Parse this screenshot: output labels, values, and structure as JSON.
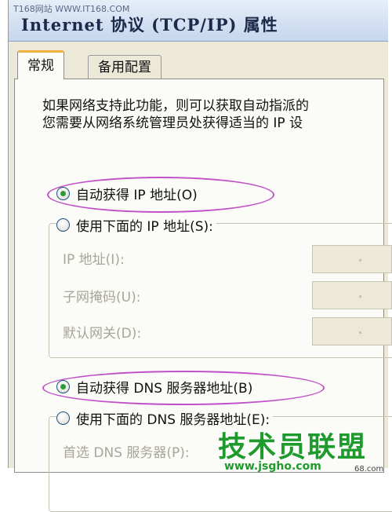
{
  "watermark_top": "T168网站 WWW.IT168.COM",
  "window": {
    "title": "Internet 协议 (TCP/IP) 属性"
  },
  "tabs": [
    {
      "label": "常规",
      "active": true
    },
    {
      "label": "备用配置",
      "active": false
    }
  ],
  "description": {
    "line1": "如果网络支持此功能，则可以获取自动指派的",
    "line2": "您需要从网络系统管理员处获得适当的 IP 设"
  },
  "ip": {
    "auto_label": "自动获得 IP 地址(O)",
    "auto_selected": true,
    "manual_label": "使用下面的 IP 地址(S):",
    "manual_selected": false,
    "fields": [
      {
        "label": "IP 地址(I):",
        "value": ""
      },
      {
        "label": "子网掩码(U):",
        "value": ""
      },
      {
        "label": "默认网关(D):",
        "value": ""
      }
    ]
  },
  "dns": {
    "auto_label": "自动获得 DNS 服务器地址(B)",
    "auto_selected": true,
    "manual_label": "使用下面的 DNS 服务器地址(E):",
    "manual_selected": false,
    "preferred_label": "首选 DNS 服务器(P):"
  },
  "logo": {
    "main": "技术员联盟",
    "url": "www.jsgho.com"
  },
  "watermark_side": "68.com",
  "colors": {
    "highlight": "#c050c8",
    "logo": "#1f9b2e",
    "radio_dot": "#2c9a38"
  }
}
